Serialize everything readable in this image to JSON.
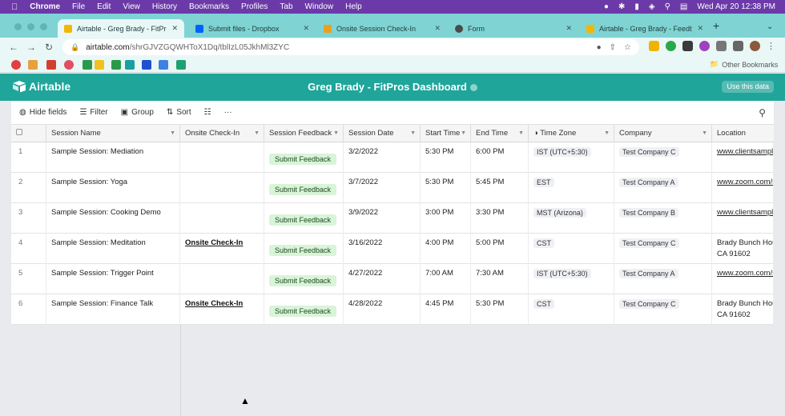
{
  "menubar": {
    "app": "Chrome",
    "items": [
      "File",
      "Edit",
      "View",
      "History",
      "Bookmarks",
      "Profiles",
      "Tab",
      "Window",
      "Help"
    ],
    "datetime": "Wed Apr 20  12:38 PM"
  },
  "tabs": [
    {
      "title": "Airtable - Greg Brady - FitPros",
      "color": "#f2b705",
      "active": true
    },
    {
      "title": "Submit files - Dropbox",
      "color": "#0061fe",
      "active": false
    },
    {
      "title": "Onsite Session Check-In",
      "color": "#e8a020",
      "active": false
    },
    {
      "title": "Form",
      "color": "#4a4a4a",
      "active": false
    },
    {
      "title": "Airtable - Greg Brady - Feedb",
      "color": "#f2b705",
      "active": false
    }
  ],
  "address": {
    "host": "airtable.com",
    "path": "/shrGJVZGQWHToX1Dq/tblIzL05JkhMl3ZYC"
  },
  "bookmarks_other": "Other Bookmarks",
  "header": {
    "logo_text": "Airtable",
    "title": "Greg Brady - FitPros Dashboard",
    "use_data": "Use this data"
  },
  "viewbar": {
    "hide_fields": "Hide fields",
    "filter": "Filter",
    "group": "Group",
    "sort": "Sort",
    "more": "···"
  },
  "columns": [
    "Session Name",
    "Onsite Check-In",
    "Session Feedback",
    "Session Date",
    "Start Time",
    "End Time",
    "Time Zone",
    "Company",
    "Location"
  ],
  "rows": [
    {
      "num": "1",
      "name": "Sample Session: Mediation",
      "checkin": "",
      "feedback": "Submit Feedback",
      "date": "3/2/2022",
      "start": "5:30 PM",
      "end": "6:00 PM",
      "tz": "IST (UTC+5:30)",
      "company": "Test Company C",
      "loc1": "www.clientsample.",
      "loc2": "",
      "loc_link": true
    },
    {
      "num": "2",
      "name": "Sample Session: Yoga",
      "checkin": "",
      "feedback": "Submit Feedback",
      "date": "3/7/2022",
      "start": "5:30 PM",
      "end": "5:45 PM",
      "tz": "EST",
      "company": "Test Company A",
      "loc1": "www.zoom.com/sa",
      "loc2": "",
      "loc_link": true
    },
    {
      "num": "3",
      "name": "Sample Session: Cooking Demo",
      "checkin": "",
      "feedback": "Submit Feedback",
      "date": "3/9/2022",
      "start": "3:00 PM",
      "end": "3:30 PM",
      "tz": "MST (Arizona)",
      "company": "Test Company B",
      "loc1": "www.clientsample.",
      "loc2": "",
      "loc_link": true
    },
    {
      "num": "4",
      "name": "Sample Session: Meditation",
      "checkin": "Onsite Check-In",
      "feedback": "Submit Feedback",
      "date": "3/16/2022",
      "start": "4:00 PM",
      "end": "5:00 PM",
      "tz": "CST",
      "company": "Test Company C",
      "loc1": "Brady Bunch Hous",
      "loc2": "CA 91602",
      "loc_link": false
    },
    {
      "num": "5",
      "name": "Sample Session: Trigger Point",
      "checkin": "",
      "feedback": "Submit Feedback",
      "date": "4/27/2022",
      "start": "7:00 AM",
      "end": "7:30 AM",
      "tz": "IST (UTC+5:30)",
      "company": "Test Company A",
      "loc1": "www.zoom.com/sa",
      "loc2": "",
      "loc_link": true
    },
    {
      "num": "6",
      "name": "Sample Session: Finance Talk",
      "checkin": "Onsite Check-In",
      "feedback": "Submit Feedback",
      "date": "4/28/2022",
      "start": "4:45 PM",
      "end": "5:30 PM",
      "tz": "CST",
      "company": "Test Company C",
      "loc1": "Brady Bunch Hous",
      "loc2": "CA 91602",
      "loc_link": false
    }
  ]
}
